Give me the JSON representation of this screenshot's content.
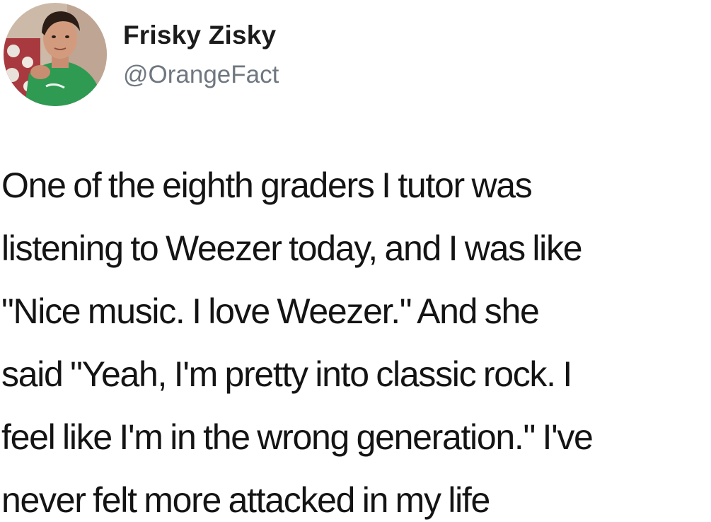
{
  "tweet": {
    "author": {
      "display_name": "Frisky Zisky",
      "handle": "@OrangeFact",
      "avatar_icon": "profile-photo-avatar"
    },
    "text_lines": [
      "One of the eighth graders I tutor was",
      "listening to Weezer today, and I was like",
      "\"Nice music. I love Weezer.\" And she",
      "said \"Yeah, I'm pretty into classic rock. I",
      "feel like I'm in the wrong generation.\" I've",
      "never felt more attacked in my life"
    ]
  },
  "colors": {
    "background": "#ffffff",
    "text": "#141414",
    "handle": "#6f7780",
    "shirt_green": "#2e9a52"
  }
}
